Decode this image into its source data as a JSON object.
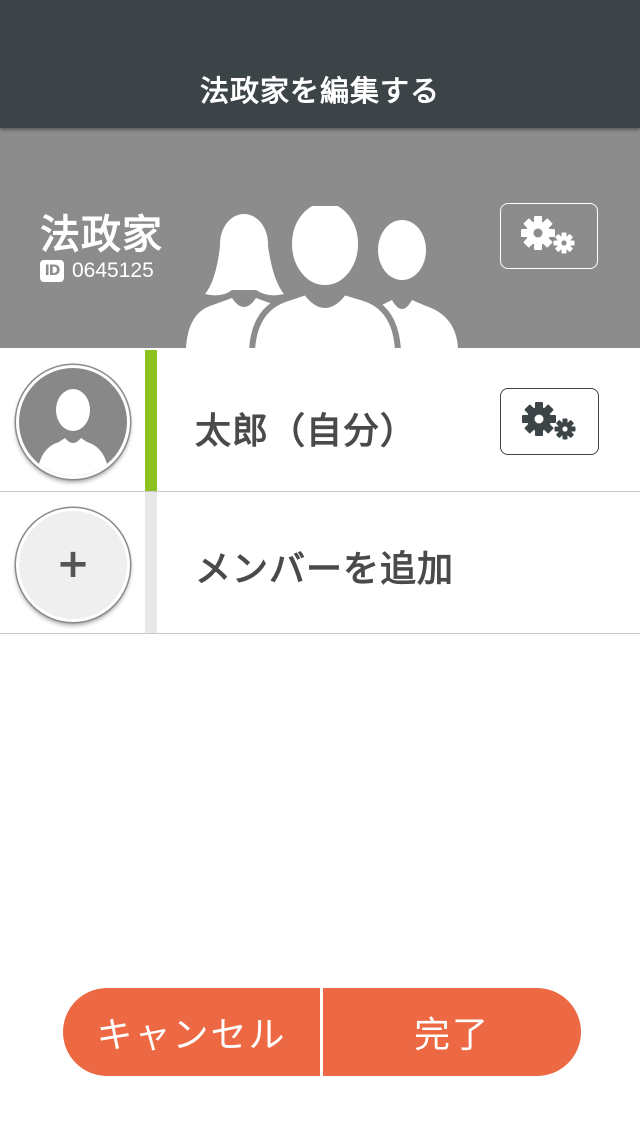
{
  "navbar": {
    "title": "法政家を編集する"
  },
  "group": {
    "name": "法政家",
    "id_badge": "ID",
    "id": "0645125",
    "settings_icon": "gears-icon"
  },
  "members": [
    {
      "name": "太郎（自分）",
      "avatar_icon": "person-icon",
      "settings_icon": "gears-icon",
      "accent_color": "#8cc21f"
    }
  ],
  "add_member": {
    "label": "メンバーを追加",
    "icon": "plus-icon",
    "glyph": "+"
  },
  "footer": {
    "cancel_label": "キャンセル",
    "done_label": "完了"
  },
  "colors": {
    "navbar": "#3d4448",
    "header_bg": "#8c8c8c",
    "accent": "#ec6943",
    "member_stripe": "#8cc21f"
  }
}
